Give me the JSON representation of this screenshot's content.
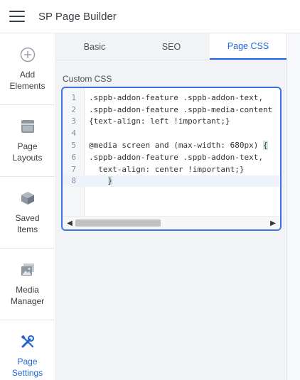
{
  "app": {
    "title": "SP Page Builder"
  },
  "sidebar": {
    "items": [
      {
        "label": "Add\nElements",
        "icon": "plus-circle-icon"
      },
      {
        "label": "Page\nLayouts",
        "icon": "layout-icon"
      },
      {
        "label": "Saved\nItems",
        "icon": "cube-icon"
      },
      {
        "label": "Media\nManager",
        "icon": "image-icon"
      },
      {
        "label": "Page\nSettings",
        "icon": "wrench-screwdriver-icon"
      }
    ]
  },
  "tabs": [
    {
      "label": "Basic"
    },
    {
      "label": "SEO"
    },
    {
      "label": "Page CSS"
    }
  ],
  "active_tab": "Page CSS",
  "editor": {
    "label": "Custom CSS",
    "lines": [
      {
        "num": "1",
        "text": ".sppb-addon-feature .sppb-addon-text,"
      },
      {
        "num": "2",
        "text": ".sppb-addon-feature .sppb-media-content"
      },
      {
        "num": "3",
        "text": "{text-align: left !important;}"
      },
      {
        "num": "4",
        "text": ""
      },
      {
        "num": "5",
        "text": "@media screen and (max-width: 680px) {"
      },
      {
        "num": "6",
        "text": ".sppb-addon-feature .sppb-addon-text,"
      },
      {
        "num": "7",
        "text": "  text-align: center !important;}"
      },
      {
        "num": "8",
        "text": "    }"
      }
    ],
    "active_line": 8
  },
  "colors": {
    "accent": "#1f63d8",
    "editor_border": "#3b71e0"
  }
}
